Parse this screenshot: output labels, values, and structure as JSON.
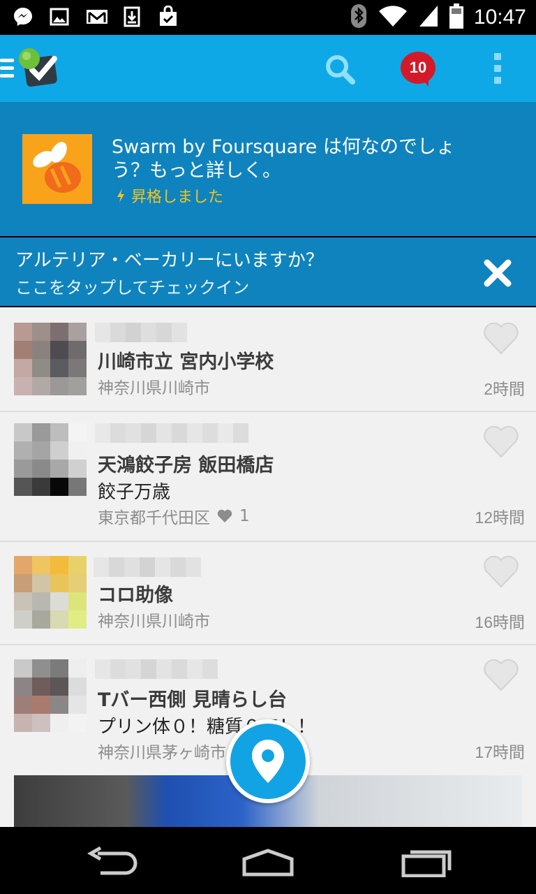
{
  "status_bar": {
    "time": "10:47",
    "left_icons": [
      "messenger-icon",
      "image-icon",
      "gmail-icon",
      "download-icon",
      "shopping-bag-icon"
    ],
    "right_icons": [
      "bluetooth-icon",
      "wifi-icon",
      "signal-icon",
      "battery-icon"
    ]
  },
  "app_bar": {
    "background": "#0fa8e6",
    "notification_count": "10"
  },
  "promo": {
    "title": "Swarm by Foursquare は何なのでしょう？もっと詳しく。",
    "status": "昇格しました"
  },
  "checkin_prompt": {
    "question": "アルテリア・ベーカリーにいますか？",
    "action": "ここをタップしてチェックイン"
  },
  "feed": [
    {
      "venue": "川崎市立 宮内小学校",
      "shout": "",
      "location": "神奈川県川崎市",
      "likes": "",
      "time": "2時間"
    },
    {
      "venue": "天鴻餃子房 飯田橋店",
      "shout": "餃子万歳",
      "location": "東京都千代田区",
      "likes": "1",
      "time": "12時間"
    },
    {
      "venue": "コロ助像",
      "shout": "",
      "location": "神奈川県川崎市",
      "likes": "",
      "time": "16時間"
    },
    {
      "venue": "Tバー西側 見晴らし台",
      "shout": "プリン体０！糖質０で！！",
      "location": "神奈川県茅ヶ崎市",
      "likes": "",
      "time": "17時間"
    }
  ]
}
